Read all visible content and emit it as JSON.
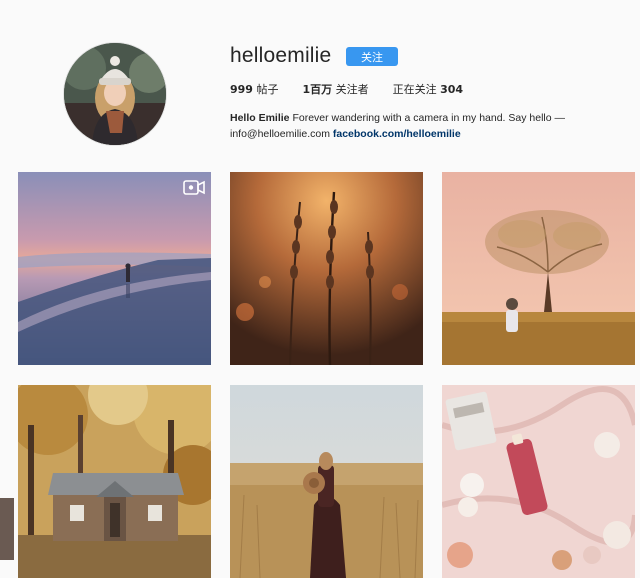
{
  "profile": {
    "username": "helloemilie",
    "follow_label": "关注",
    "stats": {
      "posts_count": "999",
      "posts_label": " 帖子",
      "followers_count": "1百万",
      "followers_label": " 关注者",
      "following_label": "正在关注 ",
      "following_count": "304"
    },
    "bio": {
      "name": "Hello Emilie",
      "text": " Forever wandering with a camera in my hand. Say hello —",
      "email": "info@helloemilie.com ",
      "link": "facebook.com/helloemilie"
    }
  },
  "grid": {
    "posts": [
      {
        "icon": "video-icon"
      },
      {},
      {},
      {},
      {},
      {}
    ]
  },
  "colors": {
    "accent": "#3897f0",
    "link": "#003569",
    "background": "#fafafa"
  }
}
